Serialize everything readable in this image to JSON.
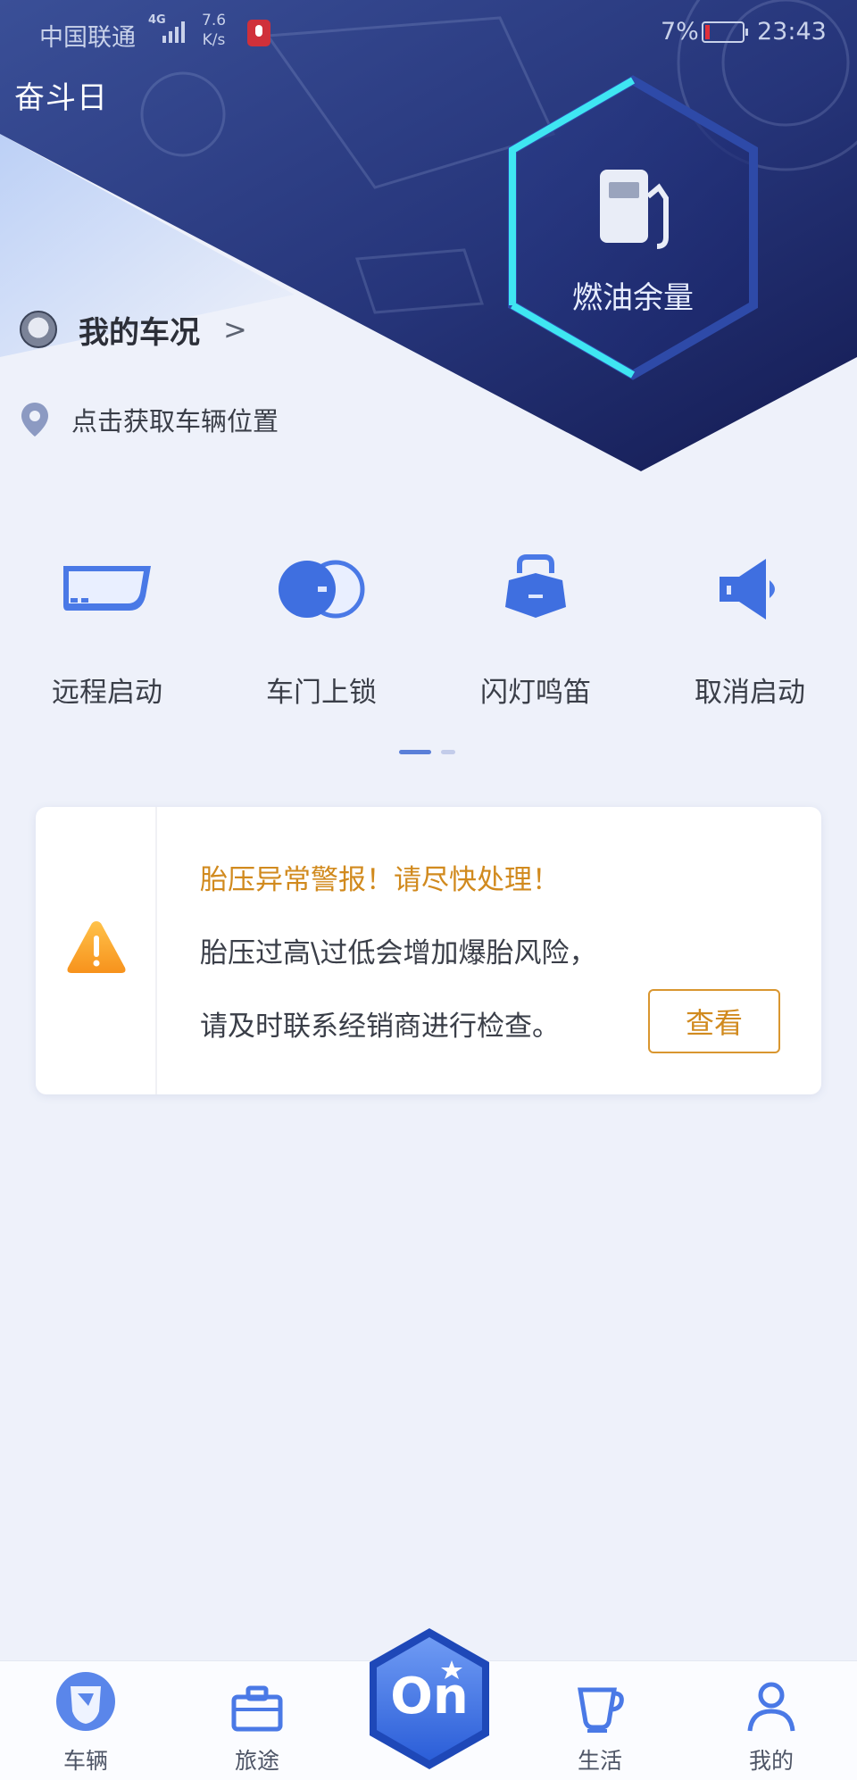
{
  "status_bar": {
    "carrier": "中国联通",
    "network": "4G",
    "speed": "7.6",
    "speed_unit": "K/s",
    "battery_percent": "7%",
    "time": "23:43"
  },
  "header": {
    "day_label": "奋斗日",
    "fuel_label": "燃油余量"
  },
  "car_status": {
    "title": "我的车况",
    "chevron": ">"
  },
  "location": {
    "text": "点击获取车辆位置"
  },
  "actions": [
    {
      "label": "远程启动",
      "icon": "remote-start-icon"
    },
    {
      "label": "车门上锁",
      "icon": "door-lock-icon"
    },
    {
      "label": "闪灯鸣笛",
      "icon": "flash-horn-icon"
    },
    {
      "label": "取消启动",
      "icon": "cancel-start-icon"
    }
  ],
  "pager": {
    "pages": 2,
    "current": 1
  },
  "alert": {
    "title": "胎压异常警报！请尽快处理！",
    "line1": "胎压过高\\过低会增加爆胎风险，",
    "line2": "请及时联系经销商进行检查。",
    "button": "查看",
    "icon": "warning-icon"
  },
  "tabbar": {
    "tabs": [
      {
        "label": "车辆",
        "icon": "vehicle-icon",
        "active": true
      },
      {
        "label": "旅途",
        "icon": "briefcase-icon",
        "active": false
      },
      {
        "label": "生活",
        "icon": "cup-icon",
        "active": false
      },
      {
        "label": "我的",
        "icon": "person-icon",
        "active": false
      }
    ],
    "center_button": "On"
  },
  "colors": {
    "accent": "#3f6fe0",
    "hero_dark": "#1c2a6e",
    "hex_glow": "#39e3f0",
    "warning": "#d18a1e",
    "background": "#eef1fa"
  }
}
